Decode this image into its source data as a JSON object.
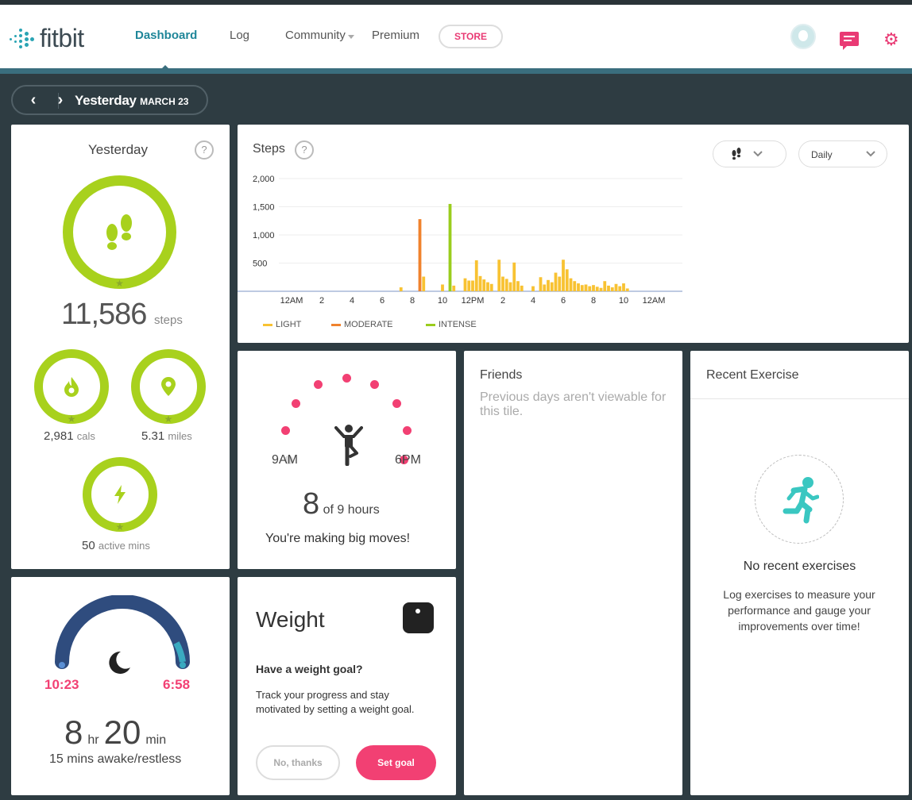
{
  "nav": {
    "logo": "fitbit",
    "links": [
      "Dashboard",
      "Log",
      "Community",
      "Premium"
    ],
    "store": "STORE",
    "brand_color": "#1f8699",
    "accent_color": "#e93a74"
  },
  "date": {
    "label": "Yesterday",
    "sub": "MARCH 23"
  },
  "summary": {
    "title": "Yesterday",
    "help": "?",
    "steps": "11,586",
    "steps_unit": "steps",
    "cals": "2,981",
    "cals_unit": "cals",
    "miles": "5.31",
    "miles_unit": "miles",
    "active": "50",
    "active_unit": "active mins"
  },
  "steps_chart": {
    "title": "Steps",
    "help": "?",
    "period": "Daily"
  },
  "chart_data": {
    "type": "bar",
    "title": "Steps",
    "ylabel": "",
    "xlabel": "",
    "ylim": [
      0,
      2000
    ],
    "yticks": [
      "2,000",
      "1,500",
      "1,000",
      "500"
    ],
    "ytick_values": [
      2000,
      1500,
      1000,
      500
    ],
    "xticks": [
      "12AM",
      "2",
      "4",
      "6",
      "8",
      "10",
      "12PM",
      "2",
      "4",
      "6",
      "8",
      "10",
      "12AM"
    ],
    "xtick_hours": [
      0,
      2,
      4,
      6,
      8,
      10,
      12,
      14,
      16,
      18,
      20,
      22,
      24
    ],
    "legend": [
      {
        "name": "LIGHT",
        "color": "#f8c232"
      },
      {
        "name": "MODERATE",
        "color": "#f0822d"
      },
      {
        "name": "INTENSE",
        "color": "#9acd1d"
      }
    ],
    "bars": [
      {
        "h": 7.25,
        "v": 70,
        "type": 0
      },
      {
        "h": 8.5,
        "v": 1280,
        "type": 1
      },
      {
        "h": 8.75,
        "v": 260,
        "type": 0
      },
      {
        "h": 10.0,
        "v": 120,
        "type": 0
      },
      {
        "h": 10.5,
        "v": 1550,
        "type": 2
      },
      {
        "h": 10.75,
        "v": 100,
        "type": 0
      },
      {
        "h": 11.5,
        "v": 230,
        "type": 0
      },
      {
        "h": 11.75,
        "v": 190,
        "type": 0
      },
      {
        "h": 12.0,
        "v": 190,
        "type": 0
      },
      {
        "h": 12.25,
        "v": 550,
        "type": 0
      },
      {
        "h": 12.5,
        "v": 270,
        "type": 0
      },
      {
        "h": 12.75,
        "v": 210,
        "type": 0
      },
      {
        "h": 13.0,
        "v": 160,
        "type": 0
      },
      {
        "h": 13.25,
        "v": 130,
        "type": 0
      },
      {
        "h": 13.75,
        "v": 560,
        "type": 0
      },
      {
        "h": 14.0,
        "v": 260,
        "type": 0
      },
      {
        "h": 14.25,
        "v": 220,
        "type": 0
      },
      {
        "h": 14.5,
        "v": 160,
        "type": 0
      },
      {
        "h": 14.75,
        "v": 510,
        "type": 0
      },
      {
        "h": 15.0,
        "v": 180,
        "type": 0
      },
      {
        "h": 15.25,
        "v": 100,
        "type": 0
      },
      {
        "h": 16.0,
        "v": 90,
        "type": 0
      },
      {
        "h": 16.5,
        "v": 250,
        "type": 0
      },
      {
        "h": 16.75,
        "v": 120,
        "type": 0
      },
      {
        "h": 17.0,
        "v": 200,
        "type": 0
      },
      {
        "h": 17.25,
        "v": 160,
        "type": 0
      },
      {
        "h": 17.5,
        "v": 330,
        "type": 0
      },
      {
        "h": 17.75,
        "v": 260,
        "type": 0
      },
      {
        "h": 18.0,
        "v": 560,
        "type": 0
      },
      {
        "h": 18.25,
        "v": 390,
        "type": 0
      },
      {
        "h": 18.5,
        "v": 230,
        "type": 0
      },
      {
        "h": 18.75,
        "v": 180,
        "type": 0
      },
      {
        "h": 19.0,
        "v": 140,
        "type": 0
      },
      {
        "h": 19.25,
        "v": 110,
        "type": 0
      },
      {
        "h": 19.5,
        "v": 120,
        "type": 0
      },
      {
        "h": 19.75,
        "v": 90,
        "type": 0
      },
      {
        "h": 20.0,
        "v": 110,
        "type": 0
      },
      {
        "h": 20.25,
        "v": 80,
        "type": 0
      },
      {
        "h": 20.5,
        "v": 60,
        "type": 0
      },
      {
        "h": 20.75,
        "v": 180,
        "type": 0
      },
      {
        "h": 21.0,
        "v": 100,
        "type": 0
      },
      {
        "h": 21.25,
        "v": 70,
        "type": 0
      },
      {
        "h": 21.5,
        "v": 130,
        "type": 0
      },
      {
        "h": 21.75,
        "v": 90,
        "type": 0
      },
      {
        "h": 22.0,
        "v": 140,
        "type": 0
      },
      {
        "h": 22.25,
        "v": 50,
        "type": 0
      }
    ]
  },
  "hourly": {
    "start": "9AM",
    "end": "6PM",
    "count": "8",
    "of": "of 9 hours",
    "message": "You're making big moves!",
    "met_color": "#f24073",
    "missed_color": "#dddddd",
    "hours_met": [
      false,
      true,
      true,
      true,
      true,
      true,
      true,
      true,
      true
    ]
  },
  "friends": {
    "title": "Friends",
    "message": "Previous days aren't viewable for this tile."
  },
  "exercise": {
    "title": "Recent Exercise",
    "heading": "No recent exercises",
    "message": "Log exercises to measure your performance and gauge your improvements over time!"
  },
  "sleep": {
    "start": "10:23",
    "end": "6:58",
    "hr": "8",
    "hr_unit": "hr",
    "min": "20",
    "min_unit": "min",
    "awake": "15 mins awake/restless"
  },
  "weight": {
    "title": "Weight",
    "heading": "Have a weight goal?",
    "body": "Track your progress and stay motivated by setting a weight goal.",
    "no_btn": "No, thanks",
    "set_btn": "Set goal"
  }
}
